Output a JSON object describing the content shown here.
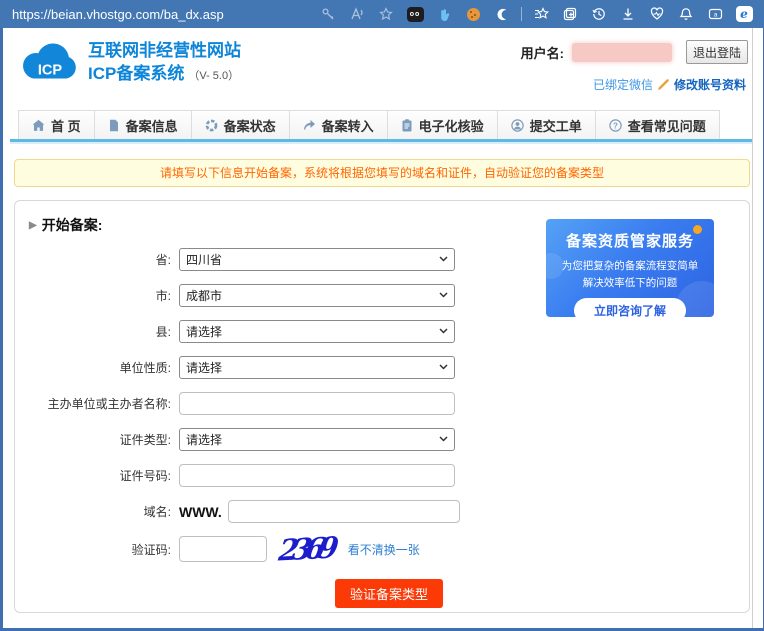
{
  "browser": {
    "url": "https://beian.vhostgo.com/ba_dx.asp",
    "toolbar_icons": [
      "password-key-icon",
      "read-aloud-icon",
      "add-favorite-star-icon",
      "extension-adblock-icon",
      "hand-extension-icon",
      "cookie-extension-icon",
      "crescent-extension-icon",
      "favorites-bar-icon",
      "collections-icon",
      "history-icon",
      "downloads-icon",
      "browser-essentials-icon",
      "notifications-bell-icon",
      "workspaces-icon",
      "edge-sidebar-icon"
    ]
  },
  "header": {
    "logo_text": "ICP",
    "title_line1": "互联网非经营性网站",
    "title_line2": "ICP备案系统",
    "version": "（V- 5.0）",
    "username_label": "用户名:",
    "logout_button": "退出登陆",
    "wechat_bound_link": "已绑定微信",
    "edit_account_link": "修改账号资料"
  },
  "nav": {
    "tabs": [
      {
        "label": "首 页",
        "icon": "home-icon"
      },
      {
        "label": "备案信息",
        "icon": "document-icon"
      },
      {
        "label": "备案状态",
        "icon": "status-circle-icon"
      },
      {
        "label": "备案转入",
        "icon": "transfer-arrow-icon"
      },
      {
        "label": "电子化核验",
        "icon": "clipboard-icon"
      },
      {
        "label": "提交工单",
        "icon": "person-icon"
      },
      {
        "label": "查看常见问题",
        "icon": "question-icon"
      }
    ]
  },
  "notice": {
    "text": "请填写以下信息开始备案，系统将根据您填写的域名和证件，自动验证您的备案类型"
  },
  "form": {
    "title": "开始备案:",
    "fields": [
      {
        "label": "省:",
        "type": "select",
        "value": "四川省"
      },
      {
        "label": "市:",
        "type": "select",
        "value": "成都市"
      },
      {
        "label": "县:",
        "type": "select",
        "value": "请选择"
      },
      {
        "label": "单位性质:",
        "type": "select",
        "value": "请选择"
      },
      {
        "label": "主办单位或主办者名称:",
        "type": "text",
        "value": ""
      },
      {
        "label": "证件类型:",
        "type": "select",
        "value": "请选择"
      },
      {
        "label": "证件号码:",
        "type": "text",
        "value": ""
      },
      {
        "label": "域名:",
        "type": "text",
        "value": "",
        "prefix": "WWW."
      },
      {
        "label": "验证码:",
        "type": "captcha",
        "value": ""
      }
    ],
    "captcha": {
      "image_text": "2369",
      "refresh_link": "看不清换一张"
    },
    "submit_button": "验证备案类型"
  },
  "promo": {
    "title": "备案资质管家服务",
    "line1": "为您把复杂的备案流程变简单",
    "line2": "解决效率低下的问题",
    "button": "立即咨询了解"
  },
  "colors": {
    "topbar_blue": "#4377b4",
    "brand_blue": "#0d85d8",
    "nav_underline": "#62b7e6",
    "notice_text": "#ff6600",
    "notice_bg": "#fffde0",
    "submit_red": "#fb3a08",
    "promo_gradient_start": "#55a2f6",
    "promo_gradient_end": "#2d63e2",
    "link_blue": "#2f7fd0",
    "captcha_blue": "#1d1dcc"
  }
}
